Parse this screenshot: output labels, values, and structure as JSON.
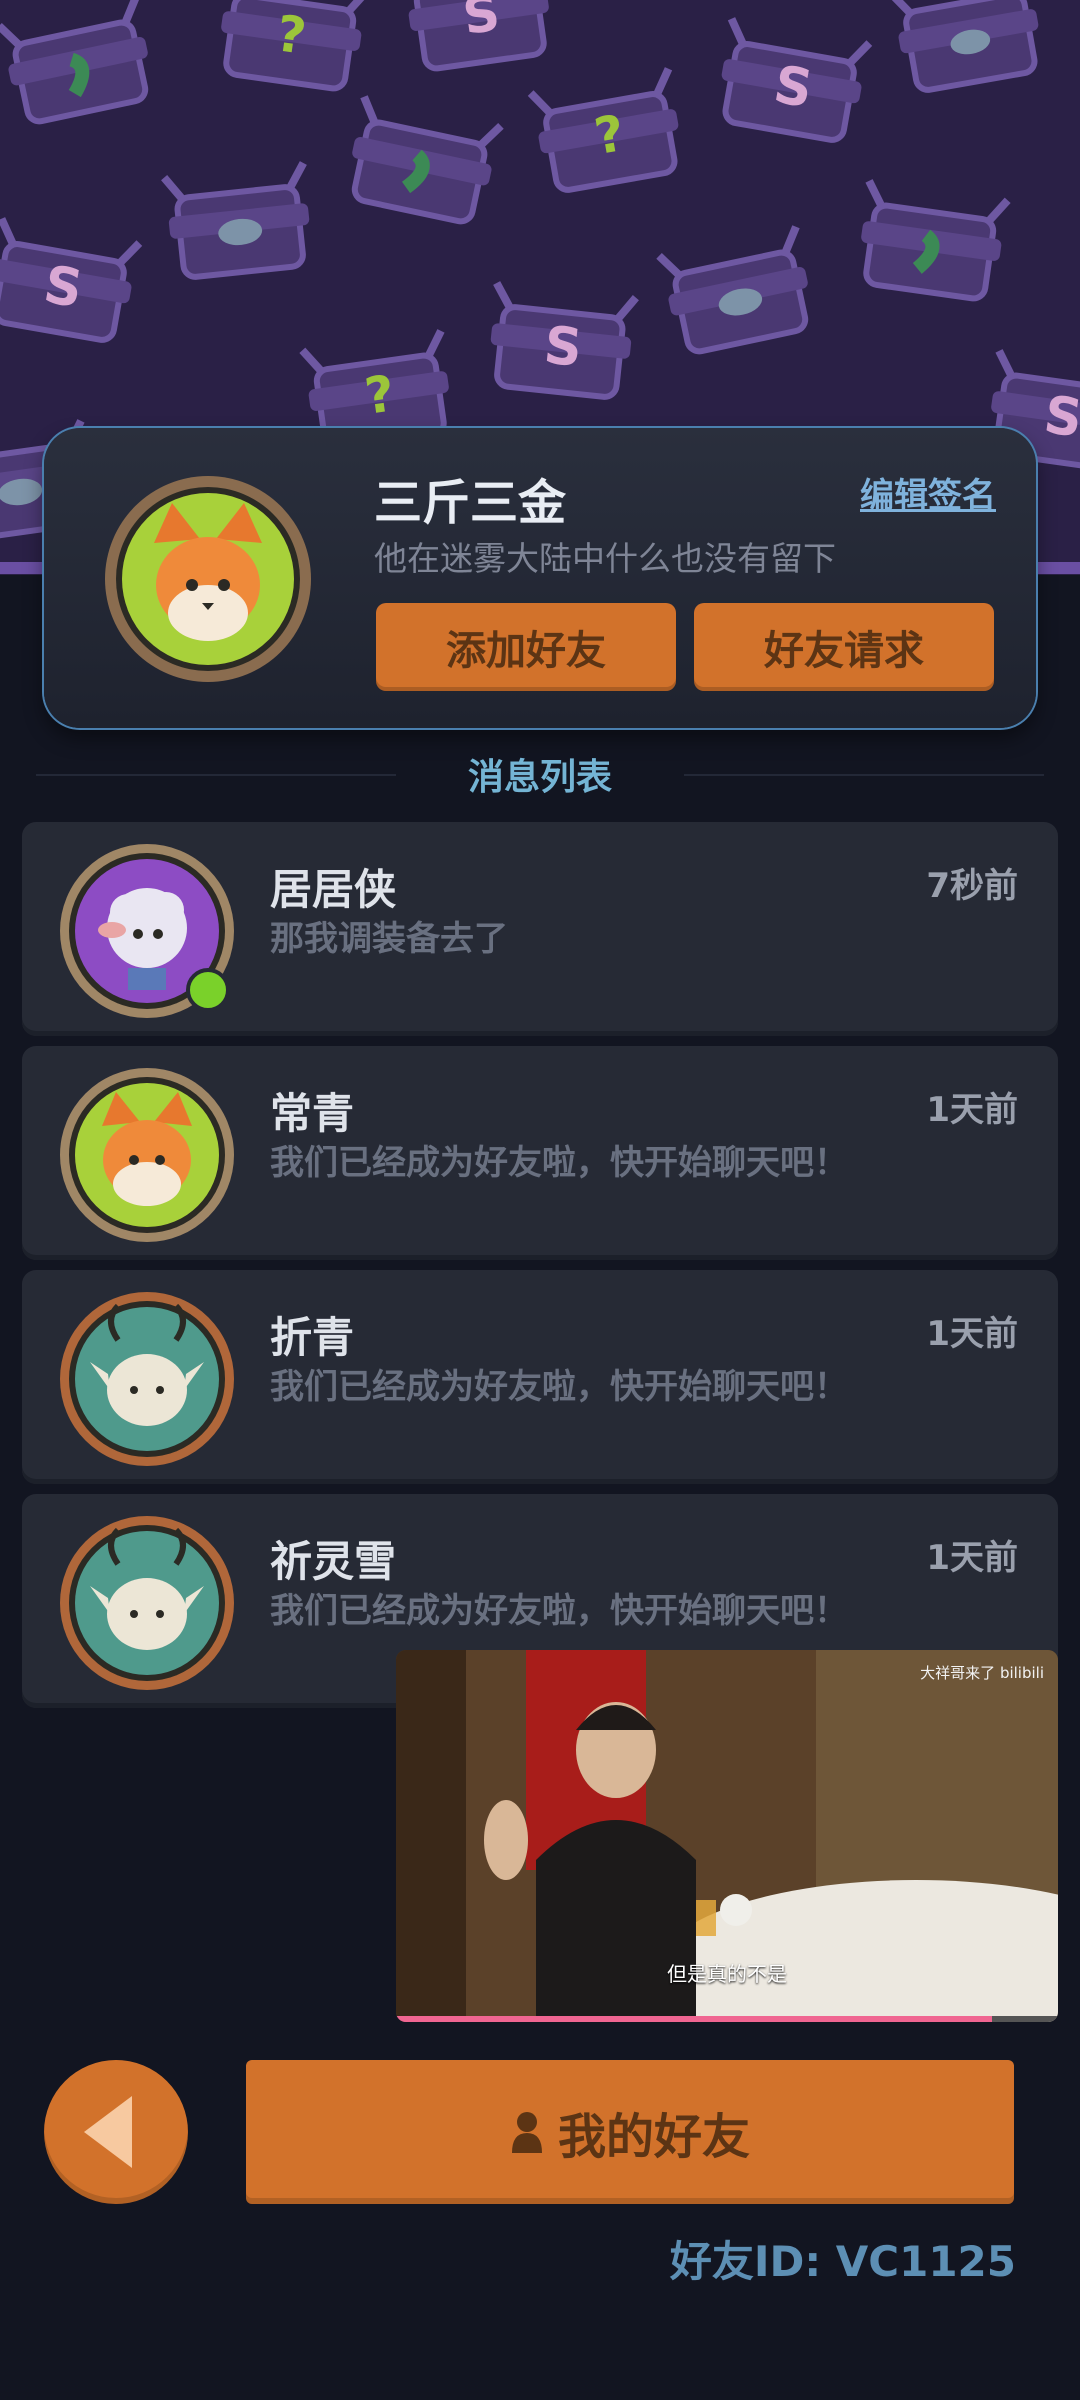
{
  "profile": {
    "name": "三斤三金",
    "signature": "他在迷雾大陆中什么也没有留下",
    "edit_signature": "编辑签名",
    "add_friend": "添加好友",
    "friend_requests": "好友请求"
  },
  "section_title": "消息列表",
  "messages": [
    {
      "name": "居居侠",
      "time": "7秒前",
      "text": "那我调装备去了",
      "avatar": "sheep-avatar",
      "online": true
    },
    {
      "name": "常青",
      "time": "1天前",
      "text": "我们已经成为好友啦，快开始聊天吧！",
      "avatar": "fox-avatar",
      "online": false
    },
    {
      "name": "折青",
      "time": "1天前",
      "text": "我们已经成为好友啦，快开始聊天吧！",
      "avatar": "deer-cat-avatar",
      "online": false
    },
    {
      "name": "祈灵雪",
      "time": "1天前",
      "text": "我们已经成为好友啦，快开始聊天吧！",
      "avatar": "deer-cat-avatar",
      "online": false
    }
  ],
  "video": {
    "watermark": "大祥哥来了 bilibili",
    "subtitle": "但是真的不是",
    "progress": 0.9
  },
  "bottom": {
    "back_icon": "triangle-left-icon",
    "my_friends": "我的好友",
    "friend_id": "好友ID: VC1125"
  },
  "colors": {
    "accent_orange": "#d2722b",
    "background": "#121521",
    "card": "#262a35",
    "link_blue": "#7fb2dc",
    "online_green": "#7ad12a"
  }
}
